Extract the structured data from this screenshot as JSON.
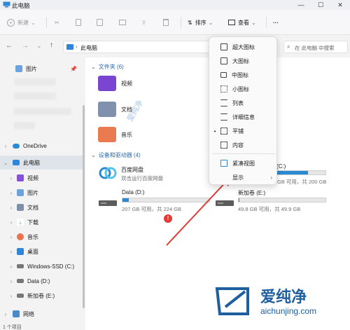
{
  "window": {
    "title": "此电脑"
  },
  "toolbar": {
    "new_label": "新建",
    "sort_label": "排序",
    "view_label": "查看",
    "more_label": "···"
  },
  "address": {
    "breadcrumb": "此电脑",
    "search_placeholder": "在 此电脑 中搜索"
  },
  "sidebar": {
    "items": [
      {
        "label": "图片"
      },
      {
        "label": "OneDrive"
      },
      {
        "label": "此电脑"
      },
      {
        "label": "视频"
      },
      {
        "label": "图片"
      },
      {
        "label": "文档"
      },
      {
        "label": "下载"
      },
      {
        "label": "音乐"
      },
      {
        "label": "桌面"
      },
      {
        "label": "Windows-SSD (C:)"
      },
      {
        "label": "Data (D:)"
      },
      {
        "label": "新加卷 (E:)"
      },
      {
        "label": "网络"
      }
    ]
  },
  "content": {
    "folders_header": "文件夹 (6)",
    "folders": [
      {
        "label": "视频"
      },
      {
        "label": "文档"
      },
      {
        "label": "音乐"
      }
    ],
    "devices_header": "设备和驱动器 (4)",
    "baidu": {
      "name": "百度网盘",
      "sub": "双击运行百度网盘"
    },
    "c_drive": {
      "name": "(C:)",
      "space": "GB 可用，共 200 GB",
      "used_fraction": 0.8
    },
    "d_drive": {
      "name": "Data (D:)",
      "space": "207 GB 可用，共 224 GB",
      "used_fraction": 0.075
    },
    "e_drive": {
      "name": "新加卷 (E:)",
      "space": "49.8 GB 可用，共 49.9 GB",
      "used_fraction": 0.01
    },
    "badge": "!"
  },
  "view_menu": {
    "items": [
      {
        "label": "超大图标"
      },
      {
        "label": "大图标"
      },
      {
        "label": "中图标"
      },
      {
        "label": "小图标"
      },
      {
        "label": "列表"
      },
      {
        "label": "详细信息"
      },
      {
        "label": "平铺"
      },
      {
        "label": "内容"
      },
      {
        "label": "紧凑视图"
      },
      {
        "label": "显示"
      }
    ]
  },
  "watermark": {
    "brand": "爱纯净",
    "site": "aichunjing.com"
  },
  "status": {
    "text": "1 个项目"
  },
  "colors": {
    "accent": "#2a8ad4",
    "arrow": "#e03a36",
    "brand": "#1f5fa0"
  }
}
